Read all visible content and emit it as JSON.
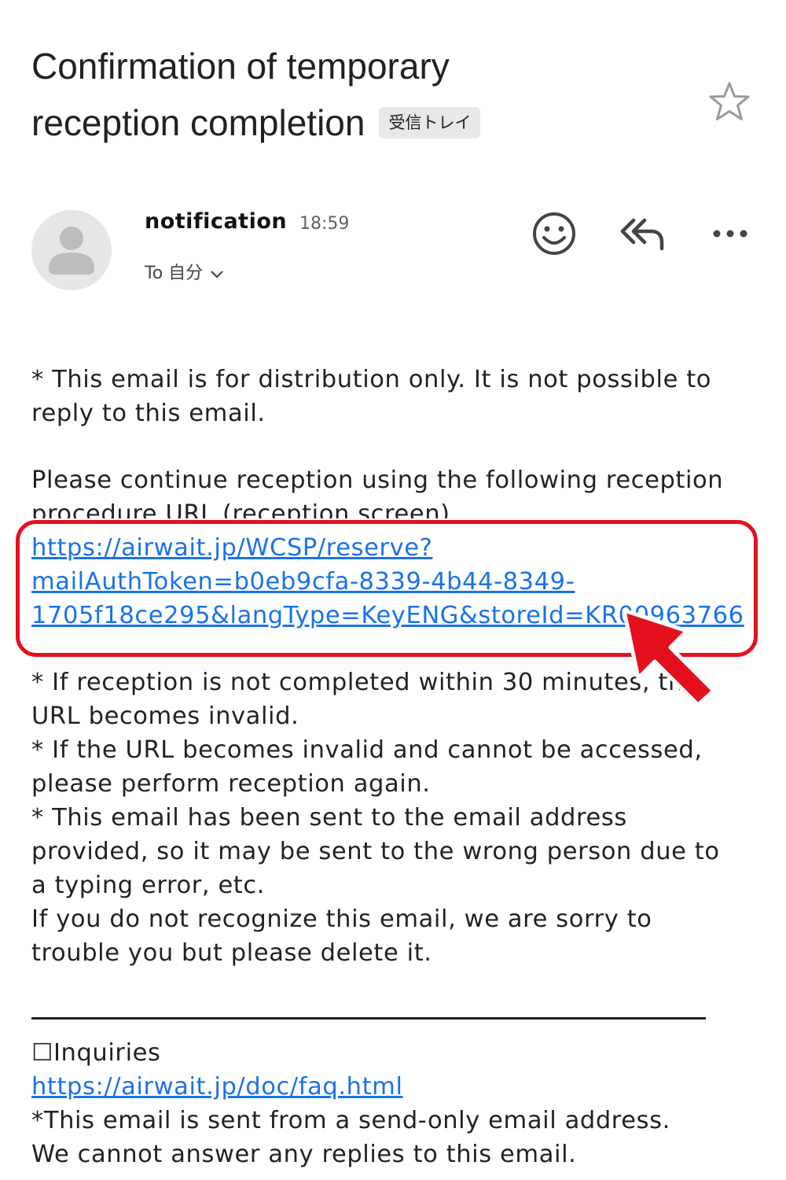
{
  "email": {
    "subject_line1": "Confirmation of temporary",
    "subject_line2": "reception completion",
    "label": "受信トレイ",
    "sender": "notification",
    "time": "18:59",
    "to_label": "To 自分"
  },
  "body": {
    "para1_l1": "* This email is for distribution only. It is not possible to",
    "para1_l2": "reply to this email.",
    "para2_l1": "Please continue reception using the following reception",
    "para2_l2": "procedure URL (reception screen)",
    "url_l1": "https://airwait.jp/WCSP/reserve?",
    "url_l2": "mailAuthToken=b0eb9cfa-8339-4b44-8349-",
    "url_l3": "1705f18ce295&langType=KeyENG&storeId=KR00963766",
    "note1_l1": "* If reception is not completed within 30 minutes, the",
    "note1_l2": "URL becomes invalid.",
    "note2_l1": "* If the URL becomes invalid and cannot be accessed,",
    "note2_l2": "please perform reception again.",
    "note3_l1": "* This email has been sent to the email address",
    "note3_l2": "provided, so it may be sent to the wrong person due to",
    "note3_l3": "a typing error, etc.",
    "note4_l1": "If you do not recognize this email, we are sorry to",
    "note4_l2": "trouble you but please delete it.",
    "inquiries": "☐Inquiries",
    "faq_url": "https://airwait.jp/doc/faq.html",
    "footer_l1": "*This email is sent from a send-only email address.",
    "footer_l2": "We cannot answer any replies to this email."
  },
  "icons": {
    "star": "star-outline-icon",
    "emoji": "smiley-icon",
    "reply_all": "reply-all-icon",
    "more": "more-horizontal-icon",
    "avatar": "person-icon",
    "chevron": "chevron-down-icon",
    "arrow": "pointer-arrow-icon"
  },
  "colors": {
    "link": "#1a73e8",
    "highlight": "#e5101e",
    "arrow": "#e5101e"
  }
}
